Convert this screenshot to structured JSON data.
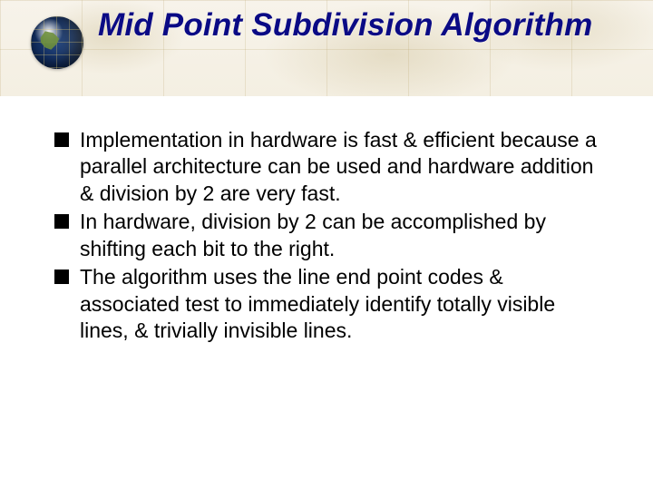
{
  "title": "Mid Point Subdivision Algorithm",
  "bullets": [
    "Implementation in hardware is fast & efficient because a parallel architecture can be used and hardware addition & division by 2 are very fast.",
    "In hardware, division by 2 can be accomplished by shifting each bit to the right.",
    "The algorithm uses the line end point codes & associated test to immediately identify totally visible lines, & trivially invisible lines."
  ]
}
